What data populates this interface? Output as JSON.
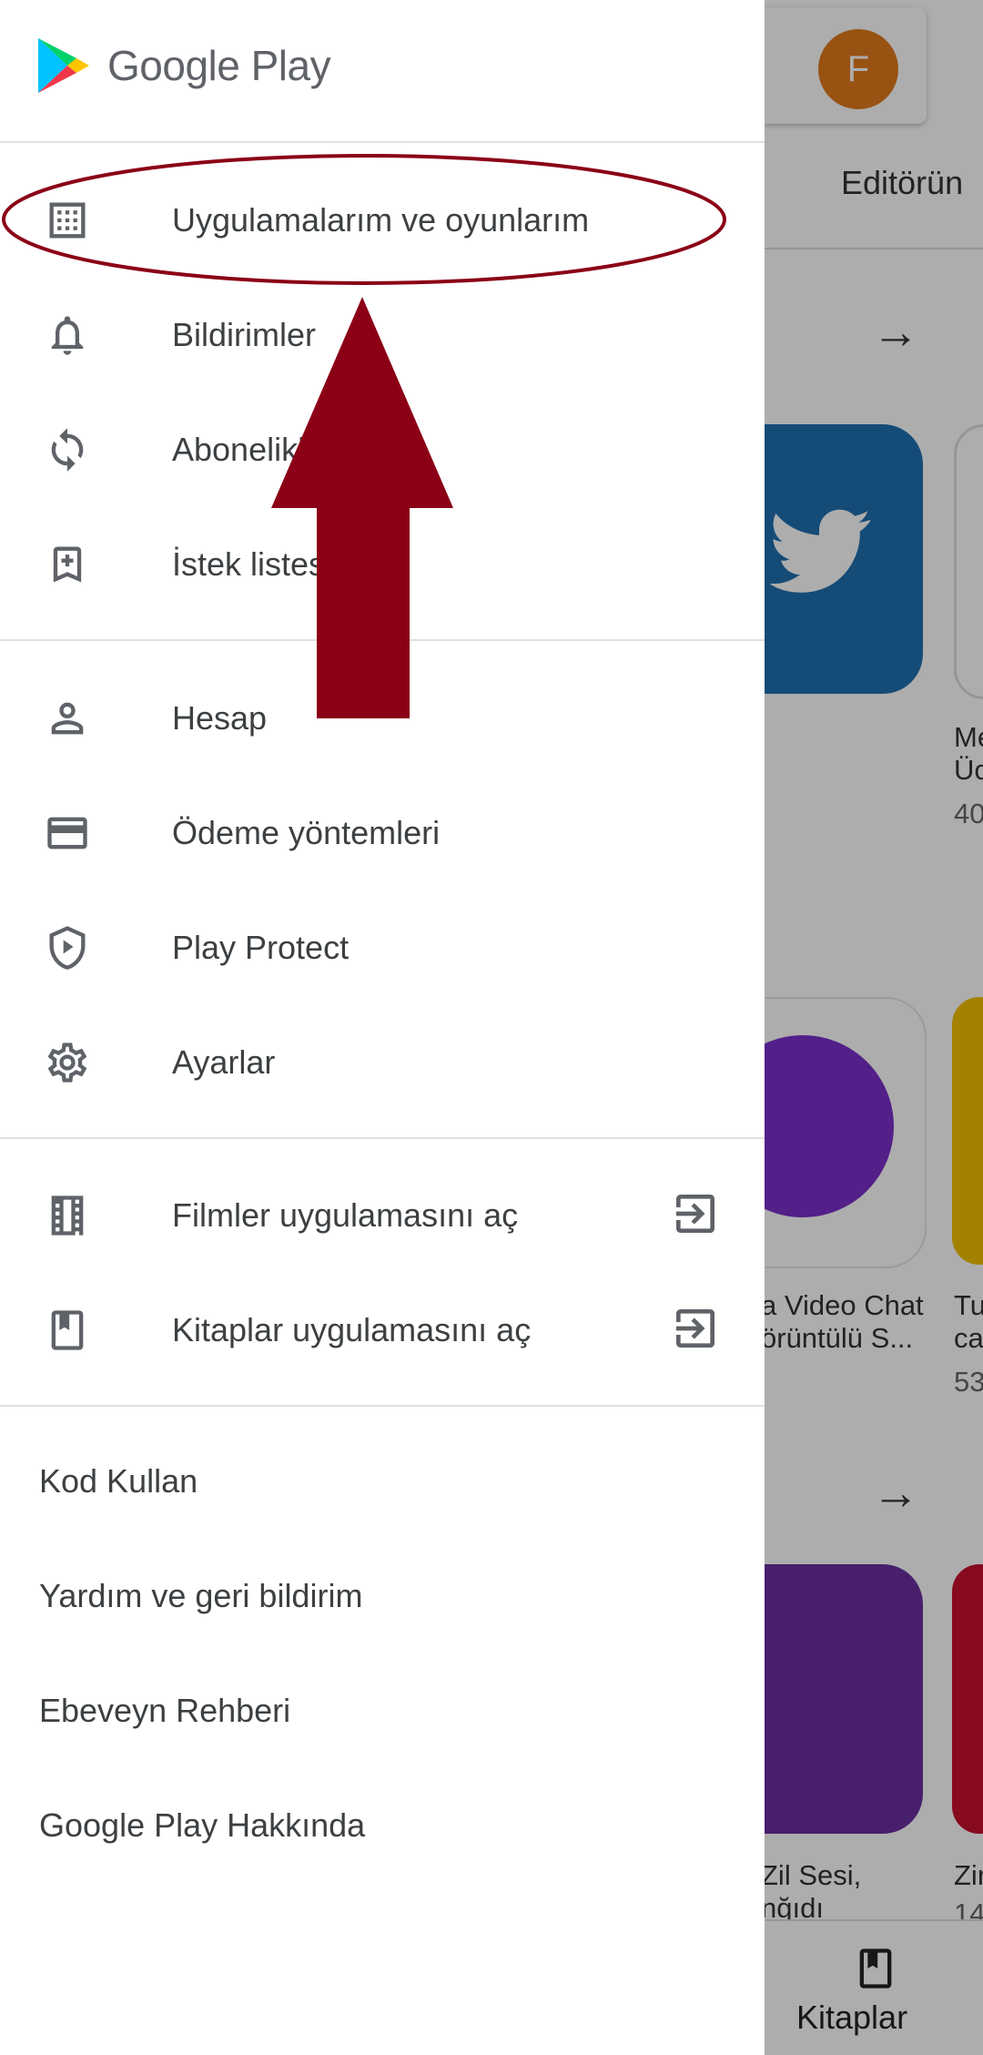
{
  "app": {
    "brand_name": "Google Play",
    "avatar_letter": "F",
    "accent_color": "#8b0016"
  },
  "background": {
    "tab_label": "Editörün",
    "bottom_nav_label": "Kitaplar",
    "snippets": {
      "row1_title_a": "Me",
      "row1_title_b": "Üc",
      "row1_meta": "40",
      "row2_title_a": "a Video Chat",
      "row2_title_b": "örüntülü S...",
      "row2_other_a": "Tu",
      "row2_other_b": "ca",
      "row2_meta": "53",
      "row3_title_a": "Zil Sesi,",
      "row3_title_b": "nğıdı",
      "row3_other": "Zir",
      "row3_meta": "14"
    }
  },
  "drawer": {
    "section1": [
      {
        "label": "Uygulamalarım ve oyunlarım",
        "icon": "apps-grid-icon"
      },
      {
        "label": "Bildirimler",
        "icon": "bell-icon"
      },
      {
        "label": "Abonelikler",
        "icon": "refresh-icon"
      },
      {
        "label": "İstek listesi",
        "icon": "bookmark-add-icon"
      }
    ],
    "section2": [
      {
        "label": "Hesap",
        "icon": "person-icon"
      },
      {
        "label": "Ödeme yöntemleri",
        "icon": "credit-card-icon"
      },
      {
        "label": "Play Protect",
        "icon": "shield-play-icon"
      },
      {
        "label": "Ayarlar",
        "icon": "gear-icon"
      }
    ],
    "section3": [
      {
        "label": "Filmler uygulamasını aç",
        "icon": "film-strip-icon",
        "trailing_icon": "open-external-icon"
      },
      {
        "label": "Kitaplar uygulamasını aç",
        "icon": "book-icon",
        "trailing_icon": "open-external-icon"
      }
    ],
    "section4": [
      {
        "label": "Kod Kullan"
      },
      {
        "label": "Yardım ve geri bildirim"
      },
      {
        "label": "Ebeveyn Rehberi"
      },
      {
        "label": "Google Play Hakkında"
      }
    ]
  }
}
